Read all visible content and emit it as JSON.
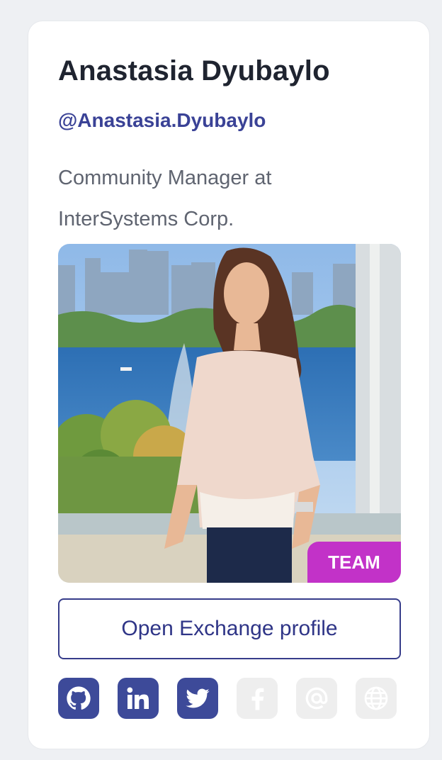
{
  "profile": {
    "name": "Anastasia Dyubaylo",
    "handle": "@Anastasia.Dyubaylo",
    "role": "Community Manager at InterSystems Corp.",
    "badge": "TEAM",
    "open_exchange_label": "Open Exchange profile"
  },
  "socials": [
    {
      "icon": "github-icon",
      "active": true
    },
    {
      "icon": "linkedin-icon",
      "active": true
    },
    {
      "icon": "twitter-icon",
      "active": true
    },
    {
      "icon": "facebook-icon",
      "active": false
    },
    {
      "icon": "email-icon",
      "active": false
    },
    {
      "icon": "website-icon",
      "active": false
    }
  ],
  "colors": {
    "accent": "#3a4296",
    "badge": "#c232c8",
    "social_active": "#3d4a99",
    "social_inactive": "#eeeeee"
  }
}
